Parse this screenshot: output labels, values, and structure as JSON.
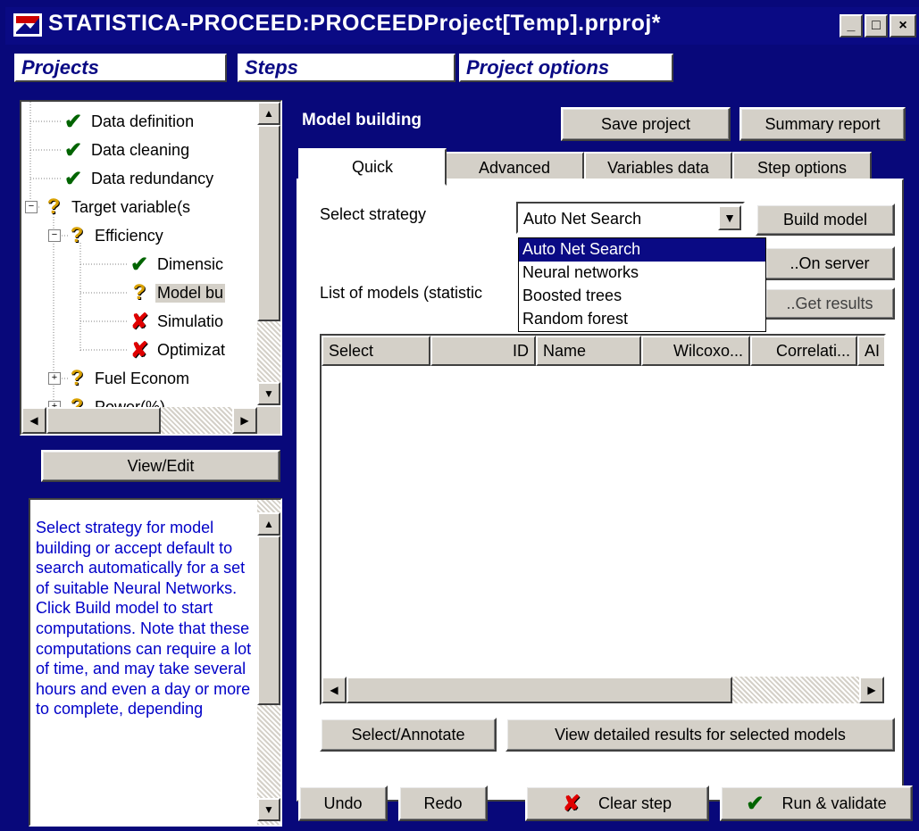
{
  "window": {
    "title": "STATISTICA-PROCEED:PROCEEDProject[Temp].prproj*",
    "min": "_",
    "max": "□",
    "close": "×"
  },
  "topTabs": {
    "projects": "Projects",
    "steps": "Steps",
    "options": "Project options"
  },
  "tree": {
    "items": [
      {
        "label": "Data definition",
        "status": "check",
        "level": 0
      },
      {
        "label": "Data cleaning",
        "status": "check",
        "level": 0
      },
      {
        "label": "Data redundancy",
        "status": "check",
        "level": 0
      },
      {
        "label": "Target variable(s",
        "status": "question",
        "level": 0
      },
      {
        "label": "Efficiency",
        "status": "question",
        "level": 1
      },
      {
        "label": "Dimensic",
        "status": "check",
        "level": 2
      },
      {
        "label": "Model bu",
        "status": "question",
        "level": 2
      },
      {
        "label": "Simulatio",
        "status": "cross",
        "level": 2
      },
      {
        "label": "Optimizat",
        "status": "cross",
        "level": 2
      },
      {
        "label": "Fuel Econom",
        "status": "question",
        "level": 1
      },
      {
        "label": "Power(%)",
        "status": "question",
        "level": 1
      }
    ]
  },
  "viewEdit": "View/Edit",
  "help": {
    "text": "Select strategy for model building or accept default to search automatically for a set of suitable Neural Networks. Click Build model to start computations. Note that these computations can require a lot of time, and may take several hours and even a day or more to complete, depending"
  },
  "main": {
    "heading": "Model building",
    "saveProject": "Save project",
    "summaryReport": "Summary report",
    "tabs": [
      "Quick",
      "Advanced",
      "Variables data",
      "Step options"
    ],
    "selectStrategy": "Select strategy",
    "strategyValue": "Auto Net Search",
    "strategyOptions": [
      "Auto Net Search",
      "Neural networks",
      "Boosted trees",
      "Random forest"
    ],
    "buildModel": "Build model",
    "onServer": "..On server",
    "getResults": "..Get results",
    "listLabel": "List of models (statistic",
    "columns": [
      "Select",
      "ID",
      "Name",
      "Wilcoxo...",
      "Correlati...",
      "AI"
    ],
    "selectAnnotate": "Select/Annotate",
    "viewDetailed": "View detailed results for selected models"
  },
  "bottom": {
    "undo": "Undo",
    "redo": "Redo",
    "clearStep": "Clear step",
    "runValidate": "Run & validate"
  },
  "colors": {
    "navy": "#08087a",
    "gray": "#d4d0c8",
    "helpText": "#0000c8",
    "check": "#006400",
    "question": "#d8a000",
    "cross": "#e00000"
  }
}
